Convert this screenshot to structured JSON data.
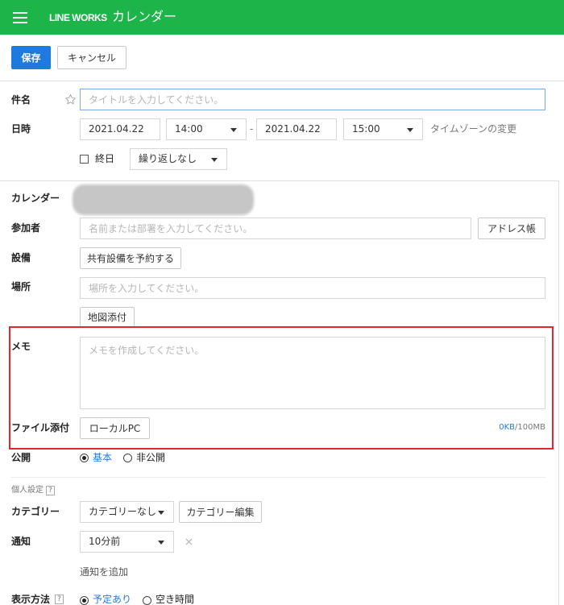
{
  "header": {
    "logo_text": "LINE WORKS",
    "app_title": "カレンダー"
  },
  "toolbar": {
    "save_label": "保存",
    "cancel_label": "キャンセル"
  },
  "form": {
    "subject": {
      "label": "件名",
      "placeholder": "タイトルを入力してください。"
    },
    "datetime": {
      "label": "日時",
      "start_date": "2021.04.22",
      "start_time": "14:00",
      "separator": "-",
      "end_date": "2021.04.22",
      "end_time": "15:00",
      "timezone_link": "タイムゾーンの変更",
      "all_day_label": "終日",
      "all_day_checked": false,
      "repeat_selected": "繰り返しなし"
    },
    "calendar": {
      "label": "カレンダー"
    },
    "attendees": {
      "label": "参加者",
      "placeholder": "名前または部署を入力してください。",
      "address_book_label": "アドレス帳"
    },
    "equipment": {
      "label": "設備",
      "reserve_label": "共有設備を予約する"
    },
    "location": {
      "label": "場所",
      "placeholder": "場所を入力してください。",
      "map_attach_label": "地図添付"
    },
    "memo": {
      "label": "メモ",
      "placeholder": "メモを作成してください。"
    },
    "attachment": {
      "label": "ファイル添付",
      "local_pc_label": "ローカルPC",
      "used": "0KB",
      "limit": "/100MB"
    },
    "visibility": {
      "label": "公開",
      "options": [
        {
          "label": "基本",
          "selected": true
        },
        {
          "label": "非公開",
          "selected": false
        }
      ]
    }
  },
  "personal": {
    "section_label": "個人設定",
    "help_symbol": "?",
    "category": {
      "label": "カテゴリー",
      "selected": "カテゴリーなし",
      "edit_label": "カテゴリー編集"
    },
    "notification": {
      "label": "通知",
      "selected": "10分前",
      "add_label": "通知を追加"
    },
    "display": {
      "label": "表示方法",
      "options": [
        {
          "label": "予定あり",
          "selected": true
        },
        {
          "label": "空き時間",
          "selected": false
        }
      ]
    }
  },
  "icons": {
    "menu": "hamburger-icon",
    "favorite": "star-icon",
    "dropdown": "chevron-down-icon",
    "checkbox": "checkbox-icon",
    "radio": "radio-icon",
    "remove": "close-icon",
    "help": "help-icon"
  },
  "colors": {
    "brand_green": "#1db449",
    "primary_blue": "#1f7ae0",
    "link_blue": "#1f7ae0",
    "focus_border": "#79abe6",
    "highlight_red": "#e3262e"
  }
}
